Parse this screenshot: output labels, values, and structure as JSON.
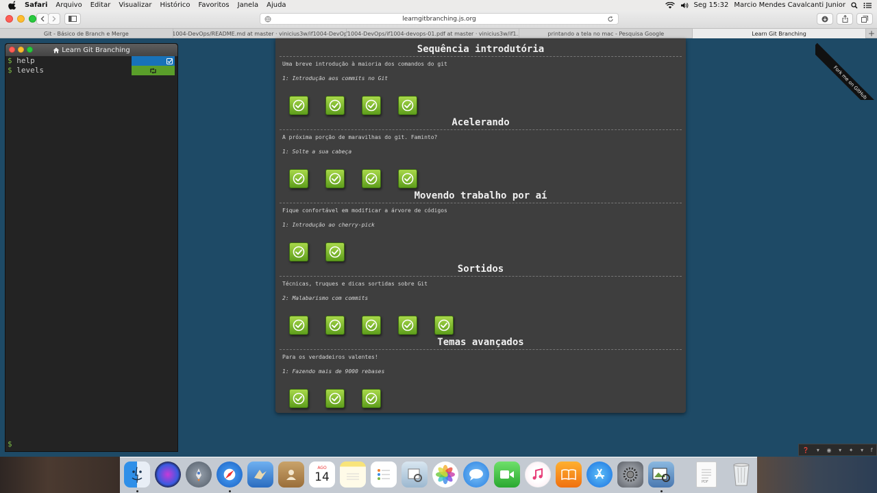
{
  "menubar": {
    "app": "Safari",
    "items": [
      "Arquivo",
      "Editar",
      "Visualizar",
      "Histórico",
      "Favoritos",
      "Janela",
      "Ajuda"
    ],
    "clock": "Seg 15:32",
    "user": "Marcio Mendes Cavalcanti Junior"
  },
  "browser": {
    "url": "learngitbranching.js.org",
    "tabs": [
      "Git - Básico de Branch e Merge",
      "if1004-DevOps/README.md at master · vinicius3w/if1004-DevOps",
      "if1004-DevOps/if1004-devops-01.pdf at master · vinicius3w/if1...",
      "printando a tela no mac - Pesquisa Google",
      "Learn Git Branching"
    ],
    "active_tab": 4
  },
  "terminal": {
    "title": "Learn Git Branching",
    "prompt_symbol": "$",
    "commands": [
      "help",
      "levels"
    ]
  },
  "sequences": [
    {
      "title": "Sequência introdutória",
      "description": "Uma breve introdução à maioria dos comandos do git",
      "subtitle": "1: Introdução aos commits no Git",
      "levels_completed": 4
    },
    {
      "title": "Acelerando",
      "description": "A próxima porção de maravilhas do git. Faminto?",
      "subtitle": "1: Solte a sua cabeça",
      "levels_completed": 4
    },
    {
      "title": "Movendo trabalho por aí",
      "description": "Fique confortável em modificar a árvore de códigos",
      "subtitle": "1: Introdução ao cherry-pick",
      "levels_completed": 2
    },
    {
      "title": "Sortidos",
      "description": "Técnicas, truques e dicas sortidas sobre Git",
      "subtitle": "2: Malabarismo com commits",
      "levels_completed": 5
    },
    {
      "title": "Temas avançados",
      "description": "Para os verdadeiros valentes!",
      "subtitle": "1: Fazendo mais de 9000 rebases",
      "levels_completed": 3
    }
  ],
  "ribbon": {
    "text": "Fork me on GitHub"
  },
  "dock": {
    "calendar_month": "AGO",
    "calendar_day": "14",
    "apps": [
      "finder-icon",
      "siri-icon",
      "launchpad-icon",
      "safari-icon",
      "mail-icon",
      "contacts-icon",
      "calendar-icon",
      "notes-icon",
      "reminders-icon",
      "preview-icon",
      "photos-icon",
      "messages-icon",
      "facetime-icon",
      "itunes-icon",
      "ibooks-icon",
      "app-store-icon",
      "system-preferences-icon",
      "photo-viewer-icon",
      "document-icon",
      "trash-icon"
    ]
  },
  "colors": {
    "desktop": "#1e4a66",
    "panel": "#3e3e3e",
    "level_complete": "#7bbd2c",
    "terminal_bg": "#232323",
    "help_badge": "#1872b8",
    "levels_badge": "#5a9e2a"
  }
}
